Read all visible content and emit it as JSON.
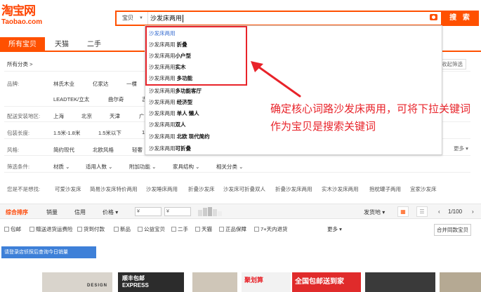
{
  "header": {
    "logo_cn": "淘宝网",
    "logo_en": "Taobao.com",
    "search_type": "宝贝",
    "search_value": "沙发床两用",
    "search_button": "搜 索"
  },
  "tabs": [
    "所有宝贝",
    "天猫",
    "二手"
  ],
  "filters": {
    "all_categories": "所有分类",
    "collapse_label": "收起筛选",
    "brand_label": "品牌:",
    "brand_row1": [
      "林氏木业",
      "亿家达",
      "一棵"
    ],
    "brand_row2": [
      "LEADTEK/立太",
      "曲尔奇",
      "吉"
    ],
    "region_label": "配送安装地区:",
    "regions": [
      "上海",
      "北京",
      "天津",
      "广"
    ],
    "length_label": "包装长度:",
    "lengths": [
      "1.5米-1.8米",
      "1.5米以下",
      "1"
    ],
    "style_label": "风格:",
    "styles": [
      "简约现代",
      "北欧风格",
      "轻奢"
    ],
    "more_label": "更多",
    "condition_label": "筛选条件:",
    "conditions": [
      "材质",
      "适用人数",
      "附加功能",
      "家具结构",
      "相关分类"
    ],
    "suggest_label": "您是不是想找:",
    "suggestions": [
      "可爱沙发床",
      "简易沙发床特价两用",
      "沙发睡床两用",
      "折叠沙发床",
      "沙发床可折叠双人",
      "折叠沙发床两用",
      "实木沙发床两用",
      "抱枕罐子两用",
      "宜家沙发床"
    ]
  },
  "sortbar": {
    "items": [
      "综合排序",
      "销量",
      "信用",
      "价格"
    ],
    "price_from": "¥",
    "price_to": "¥",
    "ship_from": "发货地",
    "page": "1/100"
  },
  "checkboxes": [
    "包邮",
    "赠送退货运费险",
    "货到付款",
    "新品",
    "公益宝贝",
    "二手",
    "天猫",
    "正品保障",
    "7+天内退货"
  ],
  "checkbox_more": "更多",
  "merge_button": "合并同款宝贝",
  "login_tip": "请登录店侦探后查询今日销量",
  "thumbs": [
    "DESIGN",
    "顺丰包邮 EXPRESS",
    "聚划算",
    "全国包邮送到家"
  ],
  "dropdown": [
    {
      "kw": "沙发床两用",
      "extra": ""
    },
    {
      "kw": "沙发床两用",
      "extra": " 折叠"
    },
    {
      "kw": "沙发床两用",
      "extra": "小户型"
    },
    {
      "kw": "沙发床两用",
      "extra": "实木"
    },
    {
      "kw": "沙发床两用",
      "extra": " 多功能"
    },
    {
      "kw": "沙发床两用",
      "extra": "多功能客厅"
    },
    {
      "kw": "沙发床两用",
      "extra": " 经济型"
    },
    {
      "kw": "沙发床两用",
      "extra": " 单人 懒人"
    },
    {
      "kw": "沙发床两用",
      "extra": "双人"
    },
    {
      "kw": "沙发床两用",
      "extra": " 北欧 现代简约"
    },
    {
      "kw": "沙发床两用",
      "extra": "可折叠"
    }
  ],
  "annotation": "确定核心词路沙发床两用，可将下拉关键词作为宝贝是搜索关键词",
  "colors": {
    "brand": "#ff5000",
    "annotation": "#e8232a",
    "login_tip": "#3e80d8"
  }
}
